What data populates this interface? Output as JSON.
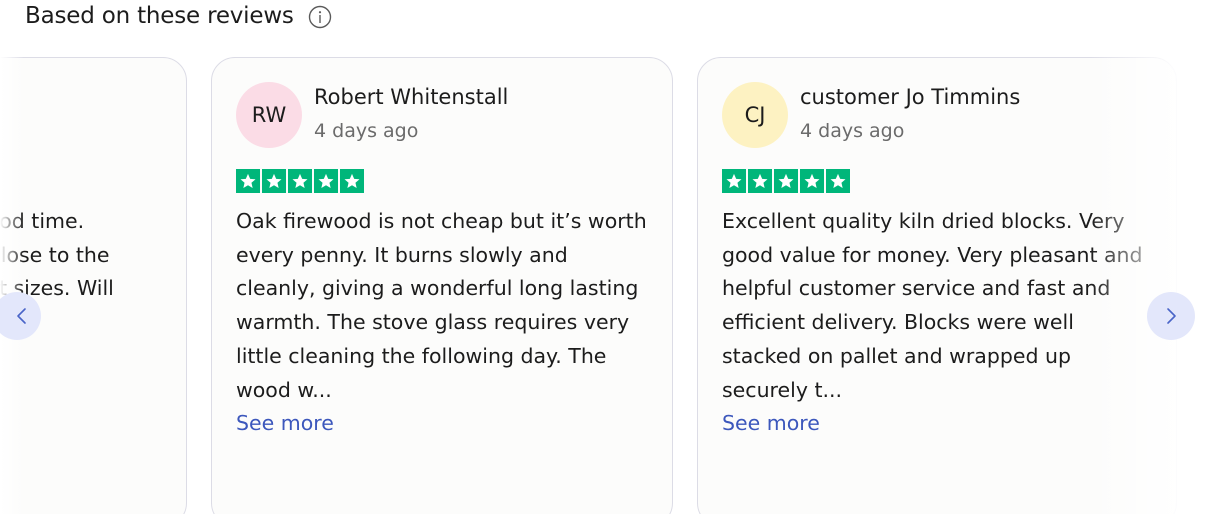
{
  "section": {
    "title": "Based on these reviews",
    "info_icon": "info-icon"
  },
  "reviews": [
    {
      "partial": true,
      "text": "Arrived promptly and in good time. Delivery driver parked as close to the door. Stacked in the correct sizes. Will definitely use agai..."
    },
    {
      "initials": "RW",
      "avatar_color": "#fbdce6",
      "name": "Robert Whitenstall",
      "date": "4 days ago",
      "rating": 5,
      "text": "Oak firewood is not cheap but it’s worth every penny. It burns slowly and cleanly, giving a wonderful long lasting warmth. The stove glass requires very little cleaning the following day. The wood w...",
      "see_more": "See more"
    },
    {
      "initials": "CJ",
      "avatar_color": "#fdf2c2",
      "name": "customer Jo Timmins",
      "date": "4 days ago",
      "rating": 5,
      "text": "Excellent quality kiln dried blocks. Very good value for money. Very pleasant and helpful customer service and fast and efficient delivery. Blocks were well stacked on pallet and wrapped up securely t...",
      "see_more": "See more"
    }
  ],
  "colors": {
    "star_green": "#00b67a",
    "link_blue": "#3c57bc",
    "nav_bg": "#e3e7fb",
    "nav_arrow": "#4a64c8"
  },
  "nav": {
    "prev_icon": "chevron-left-icon",
    "next_icon": "chevron-right-icon"
  }
}
